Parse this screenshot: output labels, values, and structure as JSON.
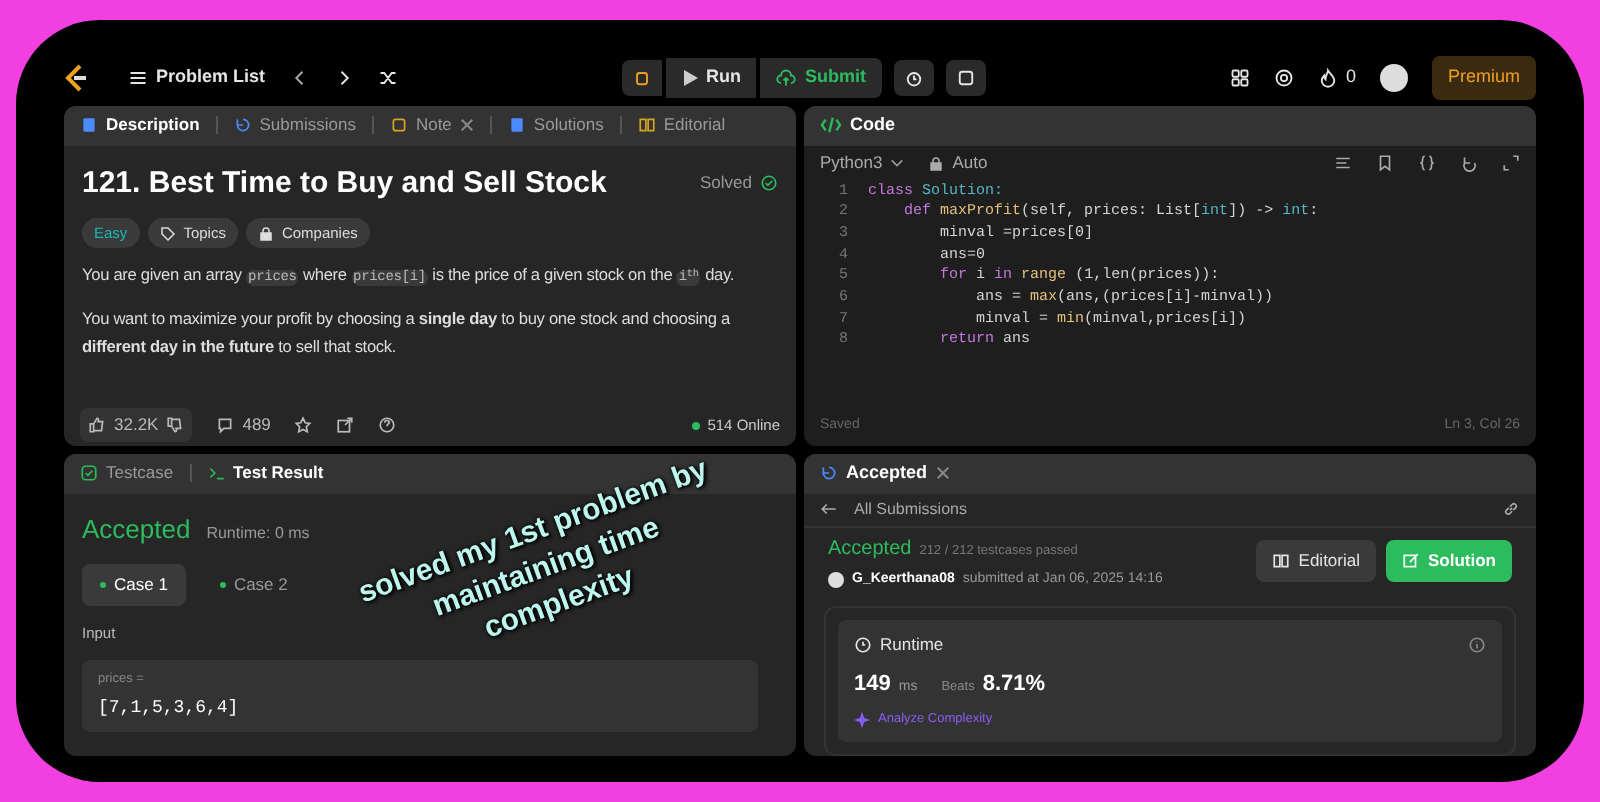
{
  "topbar": {
    "problem_list": "Problem List",
    "run": "Run",
    "submit": "Submit",
    "streak": "0",
    "premium": "Premium"
  },
  "description_panel": {
    "tabs": [
      {
        "label": "Description",
        "selected": true,
        "closable": false
      },
      {
        "label": "Submissions",
        "selected": false,
        "closable": false
      },
      {
        "label": "Note",
        "selected": false,
        "closable": true
      },
      {
        "label": "Solutions",
        "selected": false,
        "closable": false
      },
      {
        "label": "Editorial",
        "selected": false,
        "closable": false
      }
    ],
    "title": "121. Best Time to Buy and Sell Stock",
    "status": "Solved",
    "tags": [
      {
        "label": "Easy",
        "kind": "difficulty"
      },
      {
        "label": "Topics",
        "kind": "topics"
      },
      {
        "label": "Companies",
        "kind": "companies"
      }
    ],
    "paragraphs": [
      [
        {
          "text": "You are given an array ",
          "kind": "text"
        },
        {
          "text": "prices",
          "kind": "code"
        },
        {
          "text": " where ",
          "kind": "text"
        },
        {
          "text": "prices[i]",
          "kind": "code"
        },
        {
          "text": " is the price of a given stock on the ",
          "kind": "text"
        },
        {
          "text": "i$^{th}$",
          "kind": "code"
        },
        {
          "text": " day.",
          "kind": "text"
        }
      ],
      [
        {
          "text": "You want to maximize your profit by choosing a **single day** to buy one stock and choosing a **different day in the future** to sell that stock.",
          "kind": "text"
        }
      ]
    ],
    "likes": "32.2K",
    "comments": "489",
    "online": "514 Online"
  },
  "code_panel": {
    "title": "Code",
    "language": "Python3",
    "mode": "Auto",
    "lines": [
      {
        "number": "1",
        "tokens": [
          {
            "text": "class ",
            "kind": "keyword"
          },
          {
            "text": "Solution:",
            "kind": "type"
          }
        ]
      },
      {
        "number": "2",
        "tokens": [
          {
            "text": "    def ",
            "kind": "keyword"
          },
          {
            "text": "maxProfit",
            "kind": "func"
          },
          {
            "text": "(self, prices: List[",
            "kind": "plain"
          },
          {
            "text": "int",
            "kind": "type"
          },
          {
            "text": "]) -> ",
            "kind": "plain"
          },
          {
            "text": "int",
            "kind": "type"
          },
          {
            "text": ":",
            "kind": "plain"
          }
        ]
      },
      {
        "number": "3",
        "tokens": [
          {
            "text": "        minval =prices[0]",
            "kind": "plain"
          }
        ]
      },
      {
        "number": "4",
        "tokens": [
          {
            "text": "        ans=0",
            "kind": "plain"
          }
        ]
      },
      {
        "number": "5",
        "tokens": [
          {
            "text": "        for ",
            "kind": "keyword"
          },
          {
            "text": "i ",
            "kind": "plain"
          },
          {
            "text": "in ",
            "kind": "keyword"
          },
          {
            "text": "range",
            "kind": "func"
          },
          {
            "text": " (1,len(prices)):",
            "kind": "plain"
          }
        ]
      },
      {
        "number": "6",
        "tokens": [
          {
            "text": "            ans = ",
            "kind": "plain"
          },
          {
            "text": "max",
            "kind": "func"
          },
          {
            "text": "(ans,(prices[i]-minval))",
            "kind": "plain"
          }
        ]
      },
      {
        "number": "7",
        "tokens": [
          {
            "text": "            minval = ",
            "kind": "plain"
          },
          {
            "text": "min",
            "kind": "func"
          },
          {
            "text": "(minval,prices[i])",
            "kind": "plain"
          }
        ]
      },
      {
        "number": "8",
        "tokens": [
          {
            "text": "        return ",
            "kind": "keyword"
          },
          {
            "text": "ans",
            "kind": "plain"
          }
        ]
      }
    ],
    "saved": "Saved",
    "cursor": "Ln 3, Col 26"
  },
  "test_panel": {
    "tabs": [
      {
        "label": "Testcase",
        "selected": false
      },
      {
        "label": "Test Result",
        "selected": true
      }
    ],
    "result": "Accepted",
    "runtime": "Runtime: 0 ms",
    "cases": [
      {
        "label": "Case 1",
        "selected": true
      },
      {
        "label": "Case 2",
        "selected": false
      }
    ],
    "input_label": "Input",
    "param": "prices =",
    "value": "[7,1,5,3,6,4]"
  },
  "submission_panel": {
    "tab": "Accepted",
    "back": "All Submissions",
    "result": "Accepted",
    "passed": "212 / 212 testcases passed",
    "user": "G_Keerthana08",
    "submitted": "submitted at Jan 06, 2025 14:16",
    "editorial": "Editorial",
    "solution": "Solution",
    "runtime_label": "Runtime",
    "runtime_value": "149",
    "runtime_unit": "ms",
    "beats_label": "Beats",
    "beats_value": "8.71%",
    "analyze": "Analyze Complexity"
  },
  "overlay": {
    "lines": [
      "solved my 1st problem by",
      "maintaining time",
      "complexity"
    ]
  }
}
